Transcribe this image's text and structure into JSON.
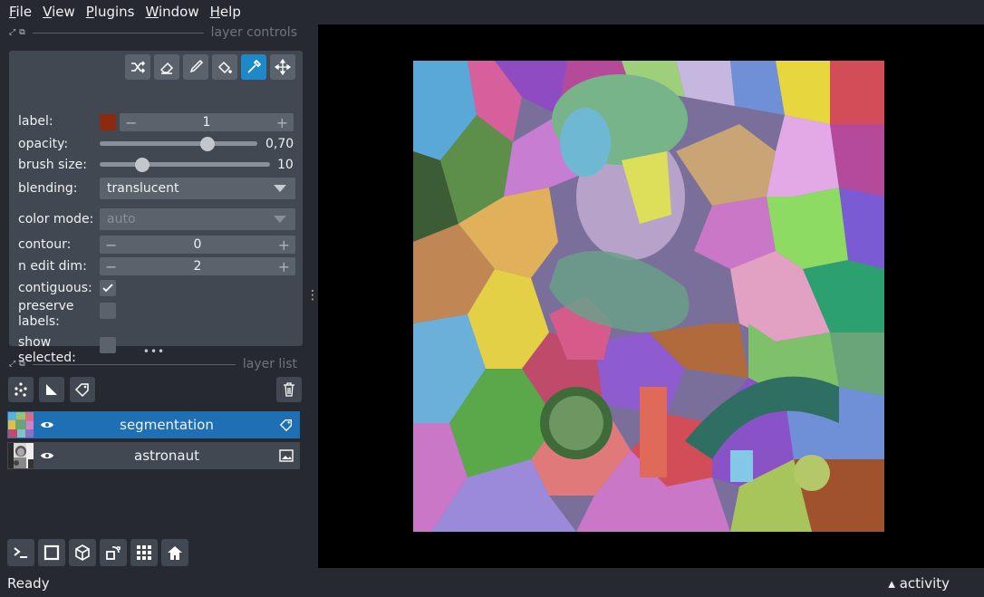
{
  "menu": [
    {
      "u": "F",
      "rest": "ile"
    },
    {
      "u": "V",
      "rest": "iew"
    },
    {
      "u": "P",
      "rest": "lugins"
    },
    {
      "u": "W",
      "rest": "indow"
    },
    {
      "u": "H",
      "rest": "elp"
    }
  ],
  "dock": {
    "controls_title": "layer controls",
    "list_title": "layer list"
  },
  "tools": [
    "shuffle-icon",
    "eraser-icon",
    "brush-icon",
    "fill-icon",
    "picker-icon",
    "move-icon"
  ],
  "controls": {
    "label": {
      "name": "label:",
      "value": "1",
      "color": "#8b2a10"
    },
    "opacity": {
      "name": "opacity:",
      "value": "0,70",
      "level": 0.7
    },
    "brush_size": {
      "name": "brush size:",
      "value": "10",
      "level": 0.25
    },
    "blending": {
      "name": "blending:",
      "value": "translucent"
    },
    "color_mode": {
      "name": "color mode:",
      "value": "auto"
    },
    "contour": {
      "name": "contour:",
      "value": "0"
    },
    "n_edit_dim": {
      "name": "n edit dim:",
      "value": "2"
    },
    "contiguous": {
      "name": "contiguous:",
      "checked": true
    },
    "preserve": {
      "name": "preserve\nlabels:",
      "checked": false
    },
    "show_selected": {
      "name": "show\nselected:",
      "checked": false
    }
  },
  "layers": [
    {
      "name": "segmentation",
      "selected": true,
      "type_icon": "labels-icon"
    },
    {
      "name": "astronaut",
      "selected": false,
      "type_icon": "image-icon"
    }
  ],
  "status": {
    "text": "Ready",
    "activity": "▴ activity"
  },
  "colors": {
    "bg": "#262930",
    "panel": "#414851",
    "accent": "#1f6fb5"
  }
}
